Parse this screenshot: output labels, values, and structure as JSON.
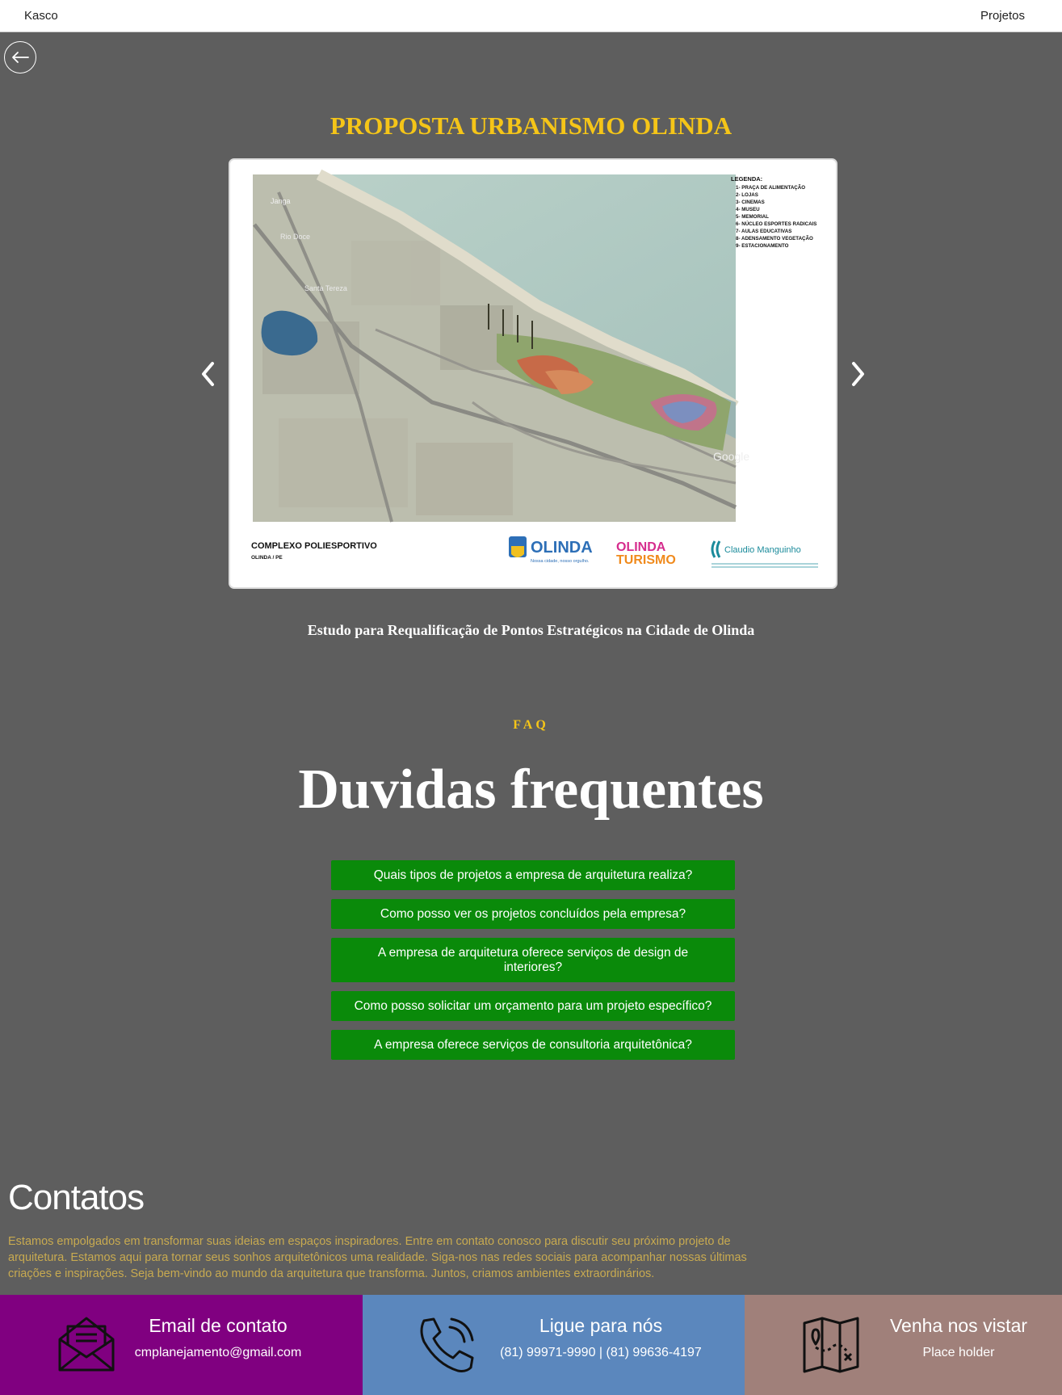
{
  "header": {
    "brand": "Kasco",
    "nav_projects": "Projetos"
  },
  "project": {
    "title": "PROPOSTA URBANISMO OLINDA",
    "description": "Estudo para Requalificação de Pontos Estratégicos na Cidade de Olinda",
    "image": {
      "top_left_label": "Janga",
      "map_labels": [
        "Rio Doce",
        "Santa Tereza"
      ],
      "legend_title": "LEGENDA:",
      "legend": [
        "1- PRAÇA DE ALIMENTAÇÃO",
        "2- LOJAS",
        "3- CINEMAS",
        "4- MUSEU",
        "5- MEMORIAL",
        "6- NÚCLEO ESPORTES RADICAIS",
        "7- AULAS EDUCATIVAS",
        "8- ADENSAMENTO VEGETAÇÃO",
        "9- ESTACIONAMENTO"
      ],
      "caption_title": "COMPLEXO POLIESPORTIVO",
      "caption_sub": "OLINDA / PE",
      "logo_olinda": "OLINDA",
      "logo_olinda_slogan": "Nossa cidade, nosso orgulho.",
      "logo_turismo_1": "OLINDA",
      "logo_turismo_2": "TURISMO",
      "logo_claudio": "Claudio Manguinho",
      "map_watermark": "Google"
    }
  },
  "faq": {
    "label": "FAQ",
    "title": "Duvidas frequentes",
    "items": [
      "Quais tipos de projetos a empresa de arquitetura realiza?",
      "Como posso ver os projetos concluídos pela empresa?",
      "A empresa de arquitetura oferece serviços de design de interiores?",
      "Como posso solicitar um orçamento para um projeto específico?",
      "A empresa oferece serviços de consultoria arquitetônica?"
    ]
  },
  "contatos": {
    "title": "Contatos",
    "text": "Estamos empolgados em transformar suas ideias em espaços inspiradores. Entre em contato conosco para discutir seu próximo projeto de arquitetura. Estamos aqui para tornar seus sonhos arquitetônicos uma realidade. Siga-nos nas redes sociais para acompanhar nossas últimas criações e inspirações. Seja bem-vindo ao mundo da arquitetura que transforma. Juntos, criamos ambientes extraordinários."
  },
  "contact_cards": {
    "email": {
      "title": "Email de contato",
      "value": "cmplanejamento@gmail.com",
      "icon": "envelope-icon",
      "color": "#800080"
    },
    "phone": {
      "title": "Ligue para nós",
      "value": "(81) 99971-9990 | (81) 99636-4197",
      "icon": "phone-icon",
      "color": "#5b87bd"
    },
    "visit": {
      "title": "Venha nos vistar",
      "value": "Place holder",
      "icon": "map-icon",
      "color": "#a0807a"
    }
  },
  "colors": {
    "background": "#5e5e5e",
    "accent_yellow": "#f5c518",
    "faq_green": "#0a8a0a"
  }
}
